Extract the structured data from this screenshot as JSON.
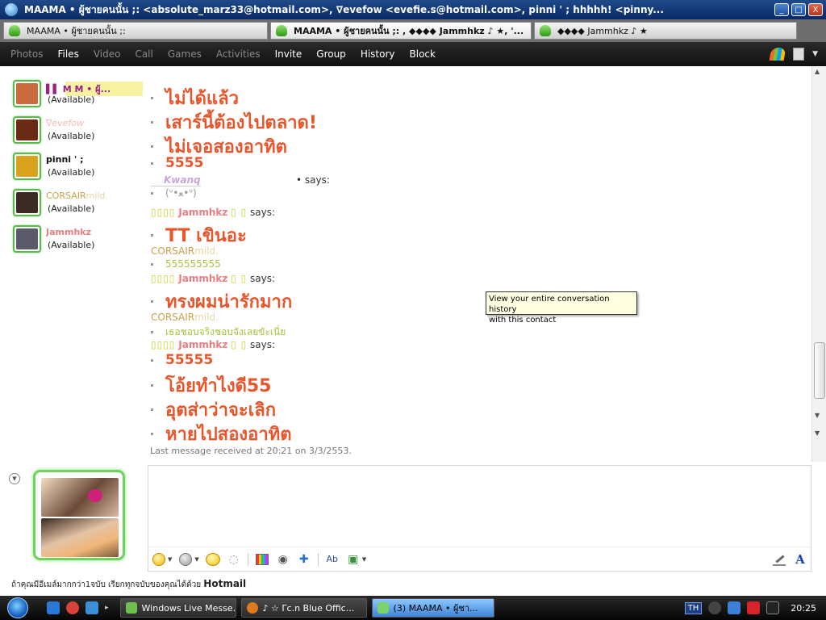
{
  "window": {
    "title": "MAAMA • ผู้ชายคนนั้น ;: <absolute_marz33@hotmail.com>, ∇evefow                              <evefie.s@hotmail.com>, pinni ' ;        hhhhh! <pinny...",
    "minimize": "_",
    "maximize": "□",
    "close": "X"
  },
  "tabs": [
    {
      "label": "MAAMA • ผู้ชายคนนั้น ;:"
    },
    {
      "label": "MAAMA • ผู้ชายคนนั้น ;: , ◆◆◆◆ Jammhkz ♪ ★, '..."
    },
    {
      "label": "◆◆◆◆ Jammhkz ♪ ★"
    }
  ],
  "menu": {
    "items": [
      {
        "label": "Photos",
        "enabled": false
      },
      {
        "label": "Files",
        "enabled": true
      },
      {
        "label": "Video",
        "enabled": false
      },
      {
        "label": "Call",
        "enabled": false
      },
      {
        "label": "Games",
        "enabled": false
      },
      {
        "label": "Activities",
        "enabled": false
      },
      {
        "label": "Invite",
        "enabled": true
      },
      {
        "label": "Group",
        "enabled": true
      },
      {
        "label": "History",
        "enabled": true
      },
      {
        "label": "Block",
        "enabled": true
      }
    ],
    "caret": "▼"
  },
  "contacts": [
    {
      "name": "▌▌ M  M  • ผู้...",
      "status": "(Available)",
      "avatar_color": "#c96b3c"
    },
    {
      "name": "∇evefow",
      "status": "(Available)",
      "avatar_color": "#6a2a14"
    },
    {
      "name": "pinni ' ;",
      "status": "(Available)",
      "avatar_color": "#d8a21a"
    },
    {
      "name": "CORSAIR",
      "name_suffix": "mild.",
      "status": "(Available)",
      "avatar_color": "#3c2a24"
    },
    {
      "name": "Jammhkz",
      "status": "(Available)",
      "avatar_color": "#5a5a6a"
    }
  ],
  "conversation": {
    "messages_a": [
      "ไม่ได้แล้ว",
      "เสาร์นี้ต้องไปตลาด!",
      "ไม่เจอสองอาทิต",
      "5555"
    ],
    "sender_kwanq": {
      "name": "Kwanq",
      "says": "• says:"
    },
    "kwanq_msg": "(ᐡ•ﻌ•ᐡ)",
    "sender_jamm": {
      "prefix": "▯▯▯▯",
      "name": "Jammhkz",
      "suffix": "▯ ▯",
      "says": "says:"
    },
    "jamm_msg_1": "TT เขินอะ",
    "sender_corsair": {
      "name": "CORSAIR",
      "suffix": "mild."
    },
    "corsair_msg_1": "555555555",
    "jamm_msg_2": "ทรงผมน่ารักมาก",
    "corsair_msg_2": "เธอชอบจริงชอบจังเลยขัะเนี่ย",
    "jamm_msgs_3": [
      "55555",
      "โอ้ยทำไงดี55",
      "อุตส่าว่าจะเลิก",
      "หายไปสองอาทิต"
    ],
    "last_message": "Last message received at 20:21 on 3/3/2553."
  },
  "tooltip": {
    "line1": "View your entire conversation history",
    "line2": "with this contact"
  },
  "compose": {
    "placeholder": ""
  },
  "toolbar": {
    "font_label": "A",
    "caret": "▼",
    "collapse": "▼"
  },
  "hotmail_ad": {
    "text": "ถ้าคุณมีอีเมล์มากกว่า1จบับ เรียกทุกจบับของคุณได้ด้วย",
    "brand": "Hotmail"
  },
  "scrollbar": {
    "up": "▲",
    "down": "▼"
  },
  "taskbar": {
    "tasks": [
      {
        "label": "Windows Live Messe...",
        "color": "#6fc04e"
      },
      {
        "label": "♪ ☆ Γc.n Blue Offic...",
        "color": "#e07a1f"
      },
      {
        "label": "(3)      MAAMA • ผู้ชา...",
        "color": "#7bd36b"
      }
    ],
    "lang": "TH",
    "clock": "20:25",
    "ql_arrow": "▸"
  }
}
